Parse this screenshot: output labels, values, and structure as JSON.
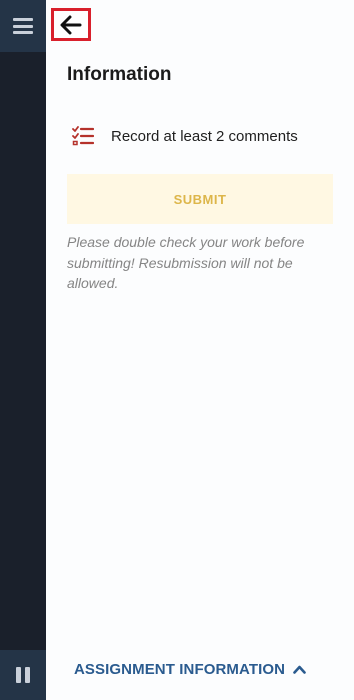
{
  "sidebar": {
    "menu_icon": "hamburger-menu-icon",
    "pause_icon": "pause-icon"
  },
  "header": {
    "back_icon": "arrow-left-icon",
    "title": "Information"
  },
  "tasks": [
    {
      "icon": "checklist-icon",
      "label": "Record at least 2 comments"
    }
  ],
  "submit": {
    "label": "SUBMIT"
  },
  "note": "Please double check your work before submitting!  Resubmission will not be allowed.",
  "footer": {
    "label": "ASSIGNMENT INFORMATION",
    "chevron_icon": "chevron-up-icon"
  },
  "colors": {
    "rail": "#1a202b",
    "rail_button": "#243447",
    "submit_bg": "#fff8e3",
    "submit_text": "#ddb64a",
    "footer_text": "#2a5b8f",
    "checklist_icon": "#b5322b",
    "highlight_border": "#d9202c"
  }
}
